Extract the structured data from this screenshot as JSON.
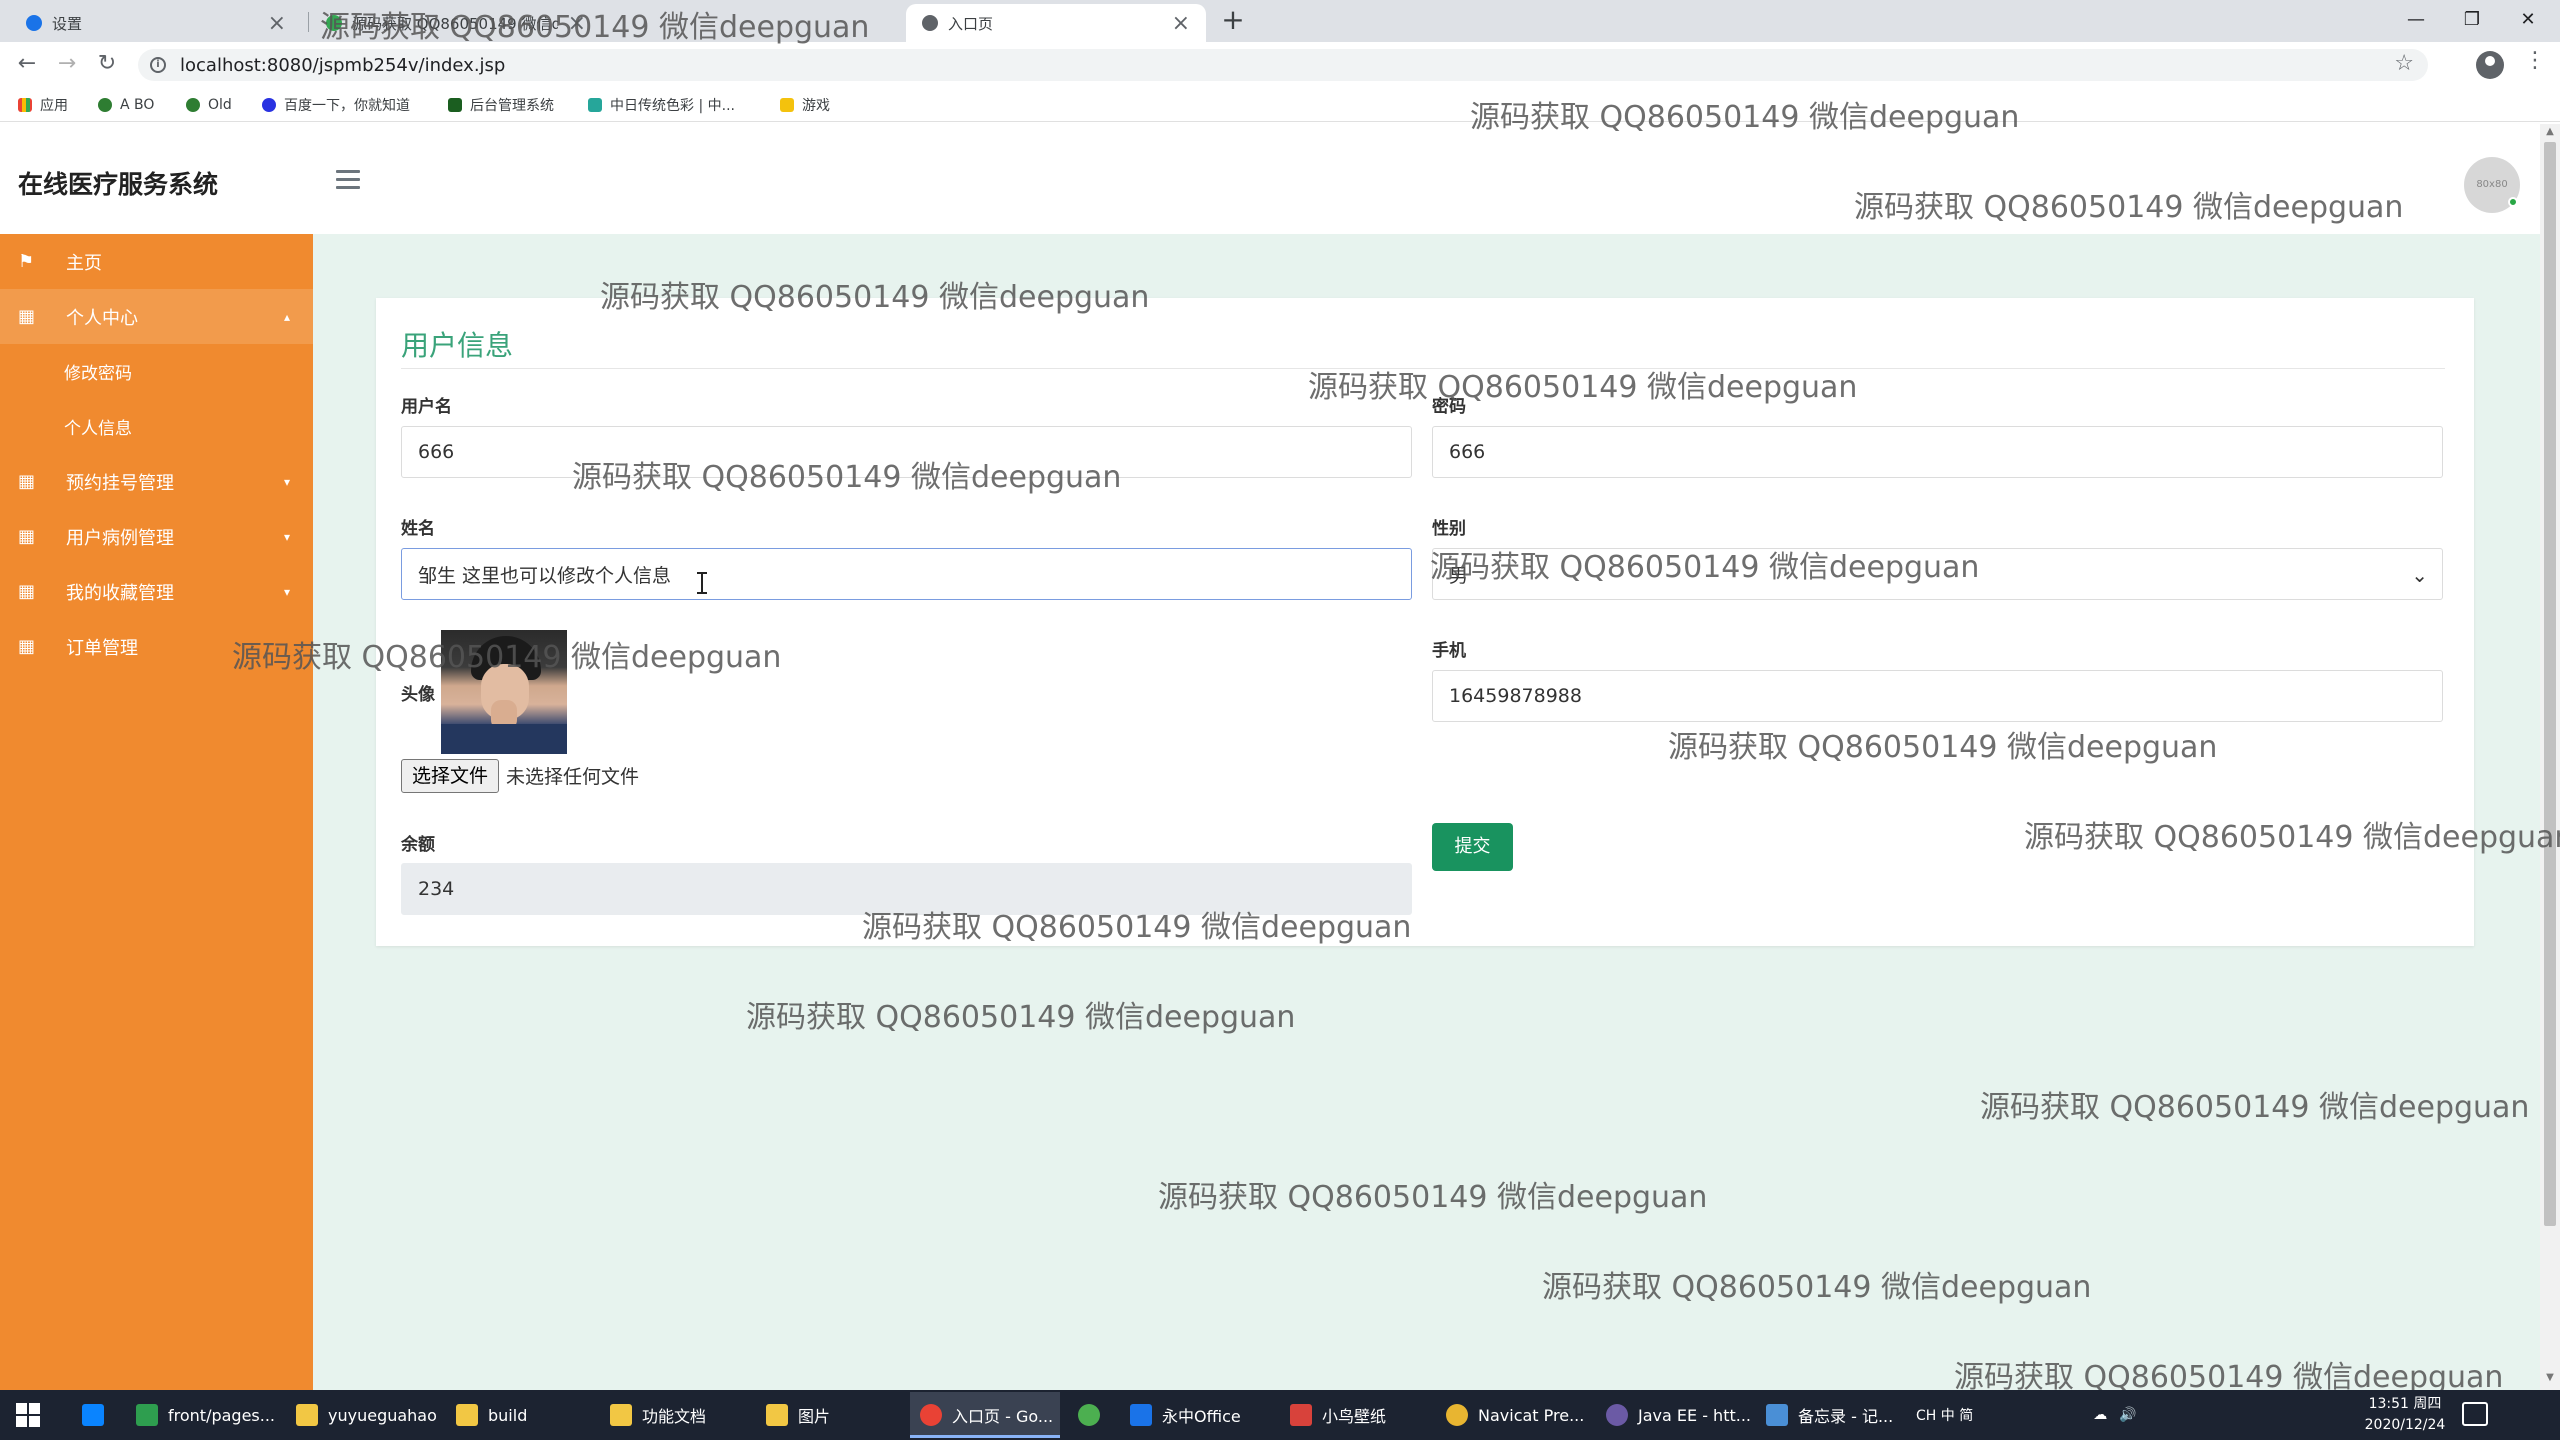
{
  "browser": {
    "tabs": [
      {
        "title": "设置",
        "close": "×"
      },
      {
        "title": "源码获取 QQ86050149 微信deepguan",
        "close": "×"
      },
      {
        "title": "入口页",
        "close": "×"
      }
    ],
    "new_tab": "+",
    "url": "localhost:8080/jspmb254v/index.jsp",
    "bookmarks": [
      "应用",
      "A BO",
      "Old",
      "百度一下，你就知道",
      "后台管理系统",
      "中日传统色彩 | 中...",
      "游戏"
    ]
  },
  "app": {
    "brand": "在线医疗服务系统",
    "avatar_text": "80x80",
    "sidebar": {
      "items": [
        {
          "label": "主页",
          "icon": "flag-icon"
        },
        {
          "label": "个人中心",
          "icon": "grid-icon",
          "caret": "▴"
        },
        {
          "label": "修改密码"
        },
        {
          "label": "个人信息"
        },
        {
          "label": "预约挂号管理",
          "icon": "grid-icon",
          "caret": "▾"
        },
        {
          "label": "用户病例管理",
          "icon": "grid-icon",
          "caret": "▾"
        },
        {
          "label": "我的收藏管理",
          "icon": "grid-icon",
          "caret": "▾"
        },
        {
          "label": "订单管理",
          "icon": "grid-icon"
        }
      ]
    },
    "form": {
      "title": "用户信息",
      "username": {
        "label": "用户名",
        "value": "666"
      },
      "password": {
        "label": "密码",
        "value": "666"
      },
      "name": {
        "label": "姓名",
        "value": "邹生 这里也可以修改个人信息"
      },
      "gender": {
        "label": "性别",
        "value": "男"
      },
      "avatar": {
        "label": "头像",
        "file_button": "选择文件",
        "file_status": "未选择任何文件"
      },
      "phone": {
        "label": "手机",
        "value": "16459878988"
      },
      "balance": {
        "label": "余额",
        "value": "234"
      },
      "submit": "提交"
    },
    "watermark": "源码获取 QQ86050149 微信deepguan"
  },
  "taskbar": {
    "items": [
      {
        "label": "front/pages...",
        "color": "#2e9e4f"
      },
      {
        "label": "yuyueguahao",
        "color": "#f2c744"
      },
      {
        "label": "build",
        "color": "#f2c744"
      },
      {
        "label": "功能文档",
        "color": "#f2c744"
      },
      {
        "label": "图片",
        "color": "#f2c744"
      },
      {
        "label": "入口页 - Go...",
        "color": "#e94235"
      },
      {
        "label": "永中Office",
        "color": "#1a73e8"
      },
      {
        "label": "小鸟壁纸",
        "color": "#d8423b"
      },
      {
        "label": "Navicat Pre...",
        "color": "#e8b531"
      },
      {
        "label": "Java EE - htt...",
        "color": "#6b5aa5"
      },
      {
        "label": "备忘录 - 记...",
        "color": "#4a8fd6"
      }
    ],
    "tray_text": "CH 中 简",
    "time": "13:51 周四",
    "date": "2020/12/24"
  }
}
